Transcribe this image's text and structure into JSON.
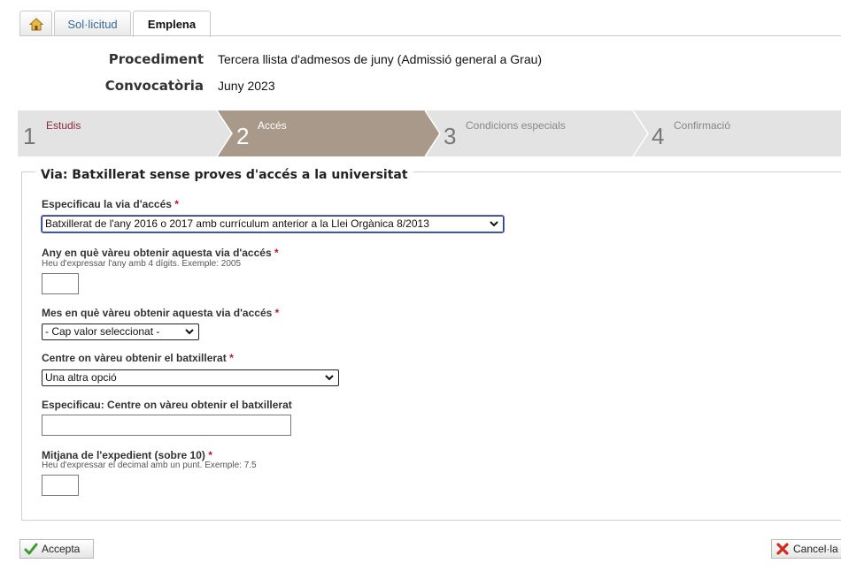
{
  "tabs": {
    "solicitud": "Sol·licitud",
    "emplena": "Emplena"
  },
  "info": {
    "procediment_label": "Procediment",
    "procediment_value": "Tercera llista d'admesos de juny (Admissió general a Grau)",
    "convocatoria_label": "Convocatòria",
    "convocatoria_value": "Juny 2023"
  },
  "steps": [
    {
      "num": "1",
      "label": "Estudis"
    },
    {
      "num": "2",
      "label": "Accés"
    },
    {
      "num": "3",
      "label": "Condicions especials"
    },
    {
      "num": "4",
      "label": "Confirmació"
    }
  ],
  "form": {
    "legend": "Via: Batxillerat sense proves d'accés a la universitat",
    "via_label": "Especificau la via d'accés",
    "via_value": "Batxillerat de l'any 2016 o 2017 amb currículum anterior a la Llei Orgànica 8/2013",
    "any_label": "Any en què vàreu obtenir aquesta via d'accés",
    "any_hint": "Heu d'expressar l'any amb 4 dígits. Exemple: 2005",
    "mes_label": "Mes en què vàreu obtenir aquesta via d'accés",
    "mes_value": "- Cap valor seleccionat -",
    "centre_label": "Centre on vàreu obtenir el batxillerat",
    "centre_value": "Una altra opció",
    "centre_esp_label": "Especificau: Centre on vàreu obtenir el batxillerat",
    "mitjana_label": "Mitjana de l'expedient (sobre 10)",
    "mitjana_hint": "Heu d'expressar el decimal amb un punt. Exemple: 7.5",
    "required_mark": "*"
  },
  "buttons": {
    "accepta": "Accepta",
    "cancel": "Cancel·la"
  },
  "colors": {
    "active_step": "#a8998a",
    "inactive_step": "#e3e3e3",
    "accent_red": "#c0142a"
  }
}
